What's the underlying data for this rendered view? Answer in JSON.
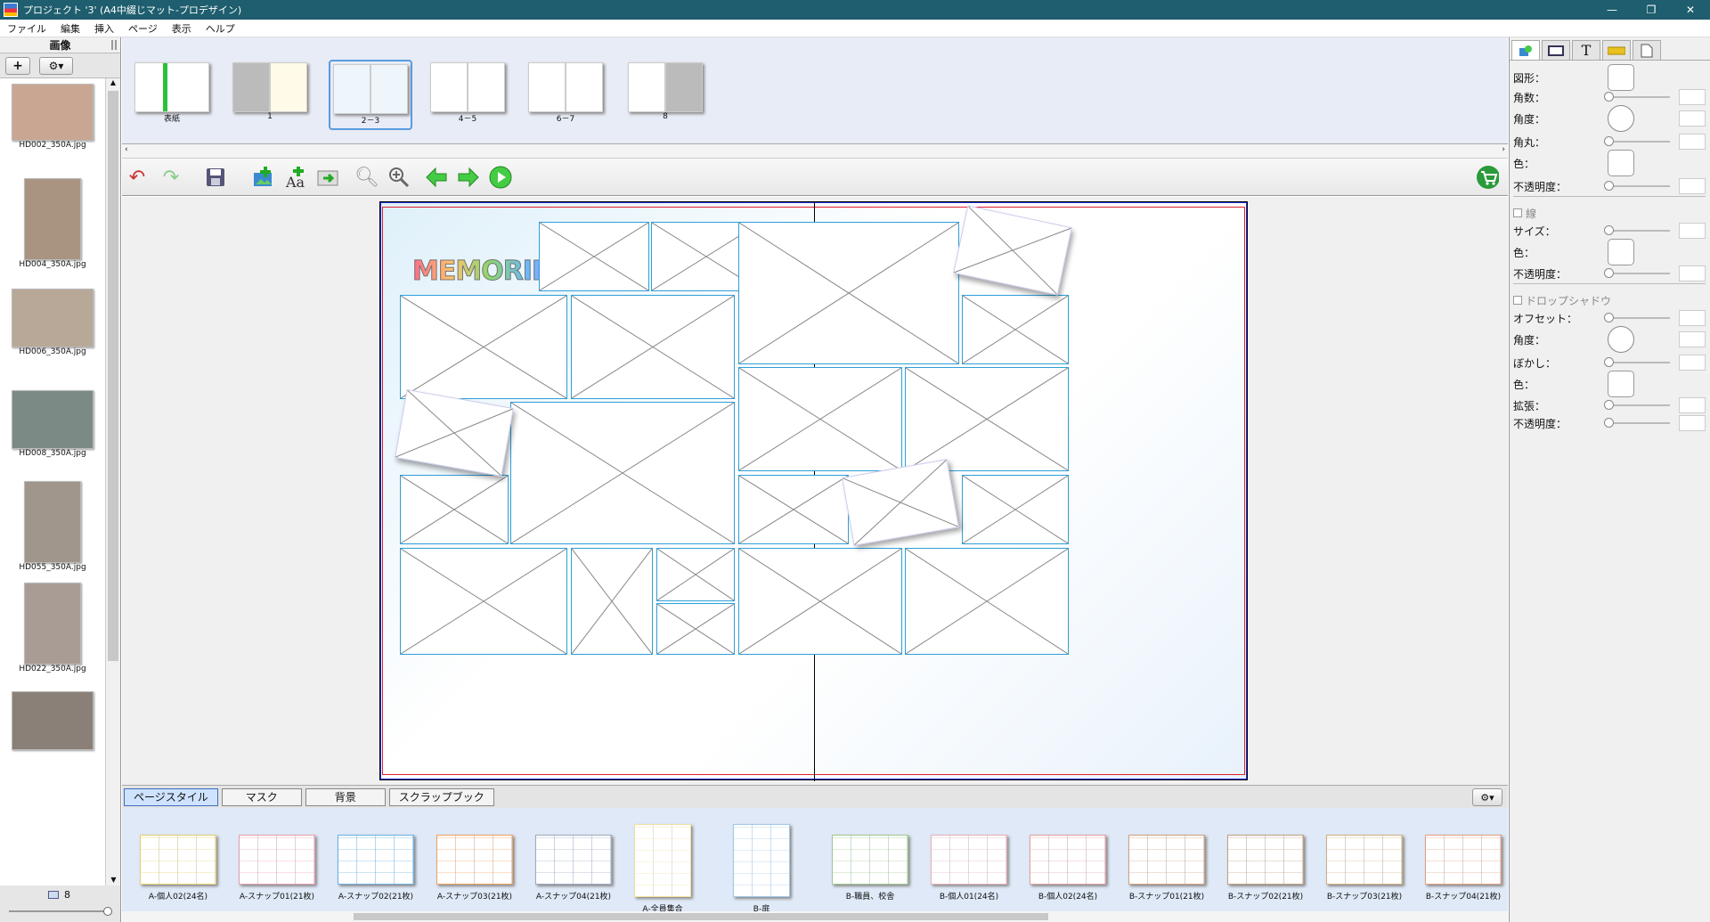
{
  "window": {
    "title": "プロジェクト '3' (A4中綴じマット-プロデザイン)",
    "minimize": "—",
    "restore": "❐",
    "close": "✕"
  },
  "menu": [
    "ファイル",
    "編集",
    "挿入",
    "ページ",
    "表示",
    "ヘルプ"
  ],
  "left_panel": {
    "title": "画像",
    "add_label": "+",
    "settings_label": "⚙▾",
    "images": [
      {
        "name": "HD002_350A.jpg",
        "color": "#c9a692"
      },
      {
        "name": "HD004_350A.jpg",
        "color": "#a89480"
      },
      {
        "name": "HD006_350A.jpg",
        "color": "#b8a898"
      },
      {
        "name": "HD008_350A.jpg",
        "color": "#7c8a86"
      },
      {
        "name": "HD055_350A.jpg",
        "color": "#a0968c"
      },
      {
        "name": "HD022_350A.jpg",
        "color": "#a89c94"
      },
      {
        "name": "",
        "color": "#8a8078"
      }
    ],
    "count": "8"
  },
  "pages": [
    {
      "label": "表紙"
    },
    {
      "label": "1"
    },
    {
      "label": "2－3"
    },
    {
      "label": "4－5"
    },
    {
      "label": "6－7"
    },
    {
      "label": "8"
    }
  ],
  "canvas": {
    "logo_text": "MEMORIES"
  },
  "bottom_tabs": [
    "ページスタイル",
    "マスク",
    "背景",
    "スクラップブック"
  ],
  "templates": [
    {
      "label": "A-個人02(24名)",
      "color": "#e6d070"
    },
    {
      "label": "A-スナップ01(21枚)",
      "color": "#e8a0b0"
    },
    {
      "label": "A-スナップ02(21枚)",
      "color": "#6ab0e0"
    },
    {
      "label": "A-スナップ03(21枚)",
      "color": "#f0a060"
    },
    {
      "label": "A-スナップ04(21枚)",
      "color": "#a0a8c0"
    },
    {
      "label": "A-全員集合",
      "color": "#f0e0a0"
    },
    {
      "label": "B-扉",
      "color": "#a0c8e8"
    },
    {
      "label": "B-職員、校舎",
      "color": "#a0c890"
    },
    {
      "label": "B-個人01(24名)",
      "color": "#e8b0b8"
    },
    {
      "label": "B-個人02(24名)",
      "color": "#e0a0a0"
    },
    {
      "label": "B-スナップ01(21枚)",
      "color": "#d0a080"
    },
    {
      "label": "B-スナップ02(21枚)",
      "color": "#c0a080"
    },
    {
      "label": "B-スナップ03(21枚)",
      "color": "#d0b080"
    },
    {
      "label": "B-スナップ04(21枚)",
      "color": "#e0a080"
    }
  ],
  "properties": {
    "shape": "図形：",
    "corners": "角数：",
    "angle": "角度：",
    "rounding": "角丸：",
    "color": "色：",
    "opacity": "不透明度：",
    "line": "線",
    "size": "サイズ：",
    "line_color": "色：",
    "line_opacity": "不透明度：",
    "shadow": "ドロップシャドウ",
    "offset": "オフセット：",
    "shadow_angle": "角度：",
    "blur": "ぼかし：",
    "shadow_color": "色：",
    "spread": "拡張：",
    "shadow_opacity": "不透明度："
  },
  "colors": {
    "titlebar": "#1e5e6e",
    "frame_border": "#2e9fd8",
    "guide_red": "#e02030",
    "guide_blue": "#2030e0"
  }
}
